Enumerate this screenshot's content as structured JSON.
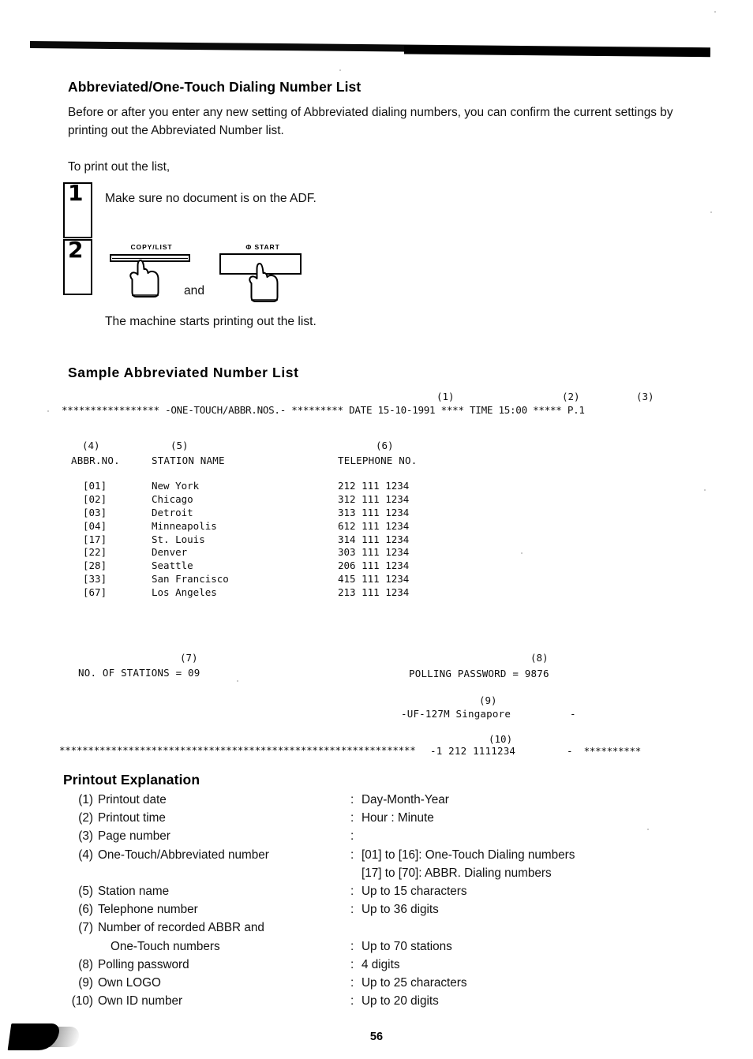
{
  "document": {
    "page_number": "56"
  },
  "section_main": {
    "heading": "Abbreviated/One-Touch Dialing Number List",
    "intro": "Before or after you enter any new setting of Abbreviated dialing numbers, you can confirm the current settings by printing out the Abbreviated Number list.",
    "print_lead": "To print out the list,"
  },
  "steps": [
    {
      "number": "1",
      "text": "Make sure no document is on the ADF."
    },
    {
      "number": "2",
      "text": "The machine starts printing out the list.",
      "conjunction": "and",
      "keys": [
        {
          "label": "COPY/LIST",
          "icon": "pointing-hand-icon"
        },
        {
          "label": "Φ  START",
          "icon": "pointing-hand-icon"
        }
      ]
    }
  ],
  "sample_list": {
    "heading": "Sample Abbreviated Number List",
    "header_line": {
      "lead_stars": "*****************",
      "title": " -ONE-TOUCH/ABBR.NOS.- ",
      "mid_stars": "*********",
      "date_label": "DATE",
      "date_value": "15-10-1991",
      "stars_after_date": "****",
      "time_label": "TIME",
      "time_value": "15:00",
      "stars_after_time": "*****",
      "page_label": "P.1",
      "full": "***************** -ONE-TOUCH/ABBR.NOS.- ********* DATE 15-10-1991 **** TIME 15:00 ***** P.1"
    },
    "markers": {
      "m1": "(1)",
      "m2": "(2)",
      "m3": "(3)",
      "m4": "(4)",
      "m5": "(5)",
      "m6": "(6)",
      "m7": "(7)",
      "m8": "(8)",
      "m9": "(9)",
      "m10": "(10)"
    },
    "columns": {
      "abbr_no": "ABBR.NO.",
      "station_name": "STATION NAME",
      "telephone_no": "TELEPHONE NO."
    },
    "rows": [
      {
        "no": "[01]",
        "name": "New York",
        "tel": "212 111 1234"
      },
      {
        "no": "[02]",
        "name": "Chicago",
        "tel": "312 111 1234"
      },
      {
        "no": "[03]",
        "name": "Detroit",
        "tel": "313 111 1234"
      },
      {
        "no": "[04]",
        "name": "Minneapolis",
        "tel": "612 111 1234"
      },
      {
        "no": "[17]",
        "name": "St. Louis",
        "tel": "314 111 1234"
      },
      {
        "no": "[22]",
        "name": "Denver",
        "tel": "303 111 1234"
      },
      {
        "no": "[28]",
        "name": "Seattle",
        "tel": "206 111 1234"
      },
      {
        "no": "[33]",
        "name": "San Francisco",
        "tel": "415 111 1234"
      },
      {
        "no": "[67]",
        "name": "Los Angeles",
        "tel": "213 111 1234"
      }
    ],
    "footer": {
      "stations": "NO. OF STATIONS = 09",
      "polling": "POLLING PASSWORD = 9876",
      "logo": "-UF-127M Singapore",
      "logo_trailing_dash": "-",
      "bottom_stars": "**************************************************************",
      "own_id": "-1 212 1111234",
      "tail": "-  **********"
    }
  },
  "explanation": {
    "heading": "Printout Explanation",
    "items": [
      {
        "num": "(1)",
        "label": "Printout date",
        "colon": ":",
        "value": "Day-Month-Year"
      },
      {
        "num": "(2)",
        "label": "Printout time",
        "colon": ":",
        "value": "Hour : Minute"
      },
      {
        "num": "(3)",
        "label": "Page number",
        "colon": ":",
        "value": ""
      },
      {
        "num": "(4)",
        "label": "One-Touch/Abbreviated number",
        "colon": ":",
        "value": "[01] to [16]: One-Touch Dialing numbers"
      },
      {
        "num": "",
        "label": "",
        "colon": "",
        "value": "[17] to [70]: ABBR. Dialing numbers"
      },
      {
        "num": "(5)",
        "label": "Station name",
        "colon": ":",
        "value": "Up to 15 characters"
      },
      {
        "num": "(6)",
        "label": "Telephone number",
        "colon": ":",
        "value": "Up to 36 digits"
      },
      {
        "num": "(7)",
        "label": "Number of recorded ABBR and",
        "colon": "",
        "value": ""
      },
      {
        "num": "",
        "label": "One-Touch numbers",
        "colon": ":",
        "value": "Up to 70 stations"
      },
      {
        "num": "(8)",
        "label": "Polling password",
        "colon": ":",
        "value": "4 digits"
      },
      {
        "num": "(9)",
        "label": "Own LOGO",
        "colon": ":",
        "value": "Up to 25 characters"
      },
      {
        "num": "(10)",
        "label": "Own ID number",
        "colon": ":",
        "value": "Up to 20 digits"
      }
    ]
  }
}
